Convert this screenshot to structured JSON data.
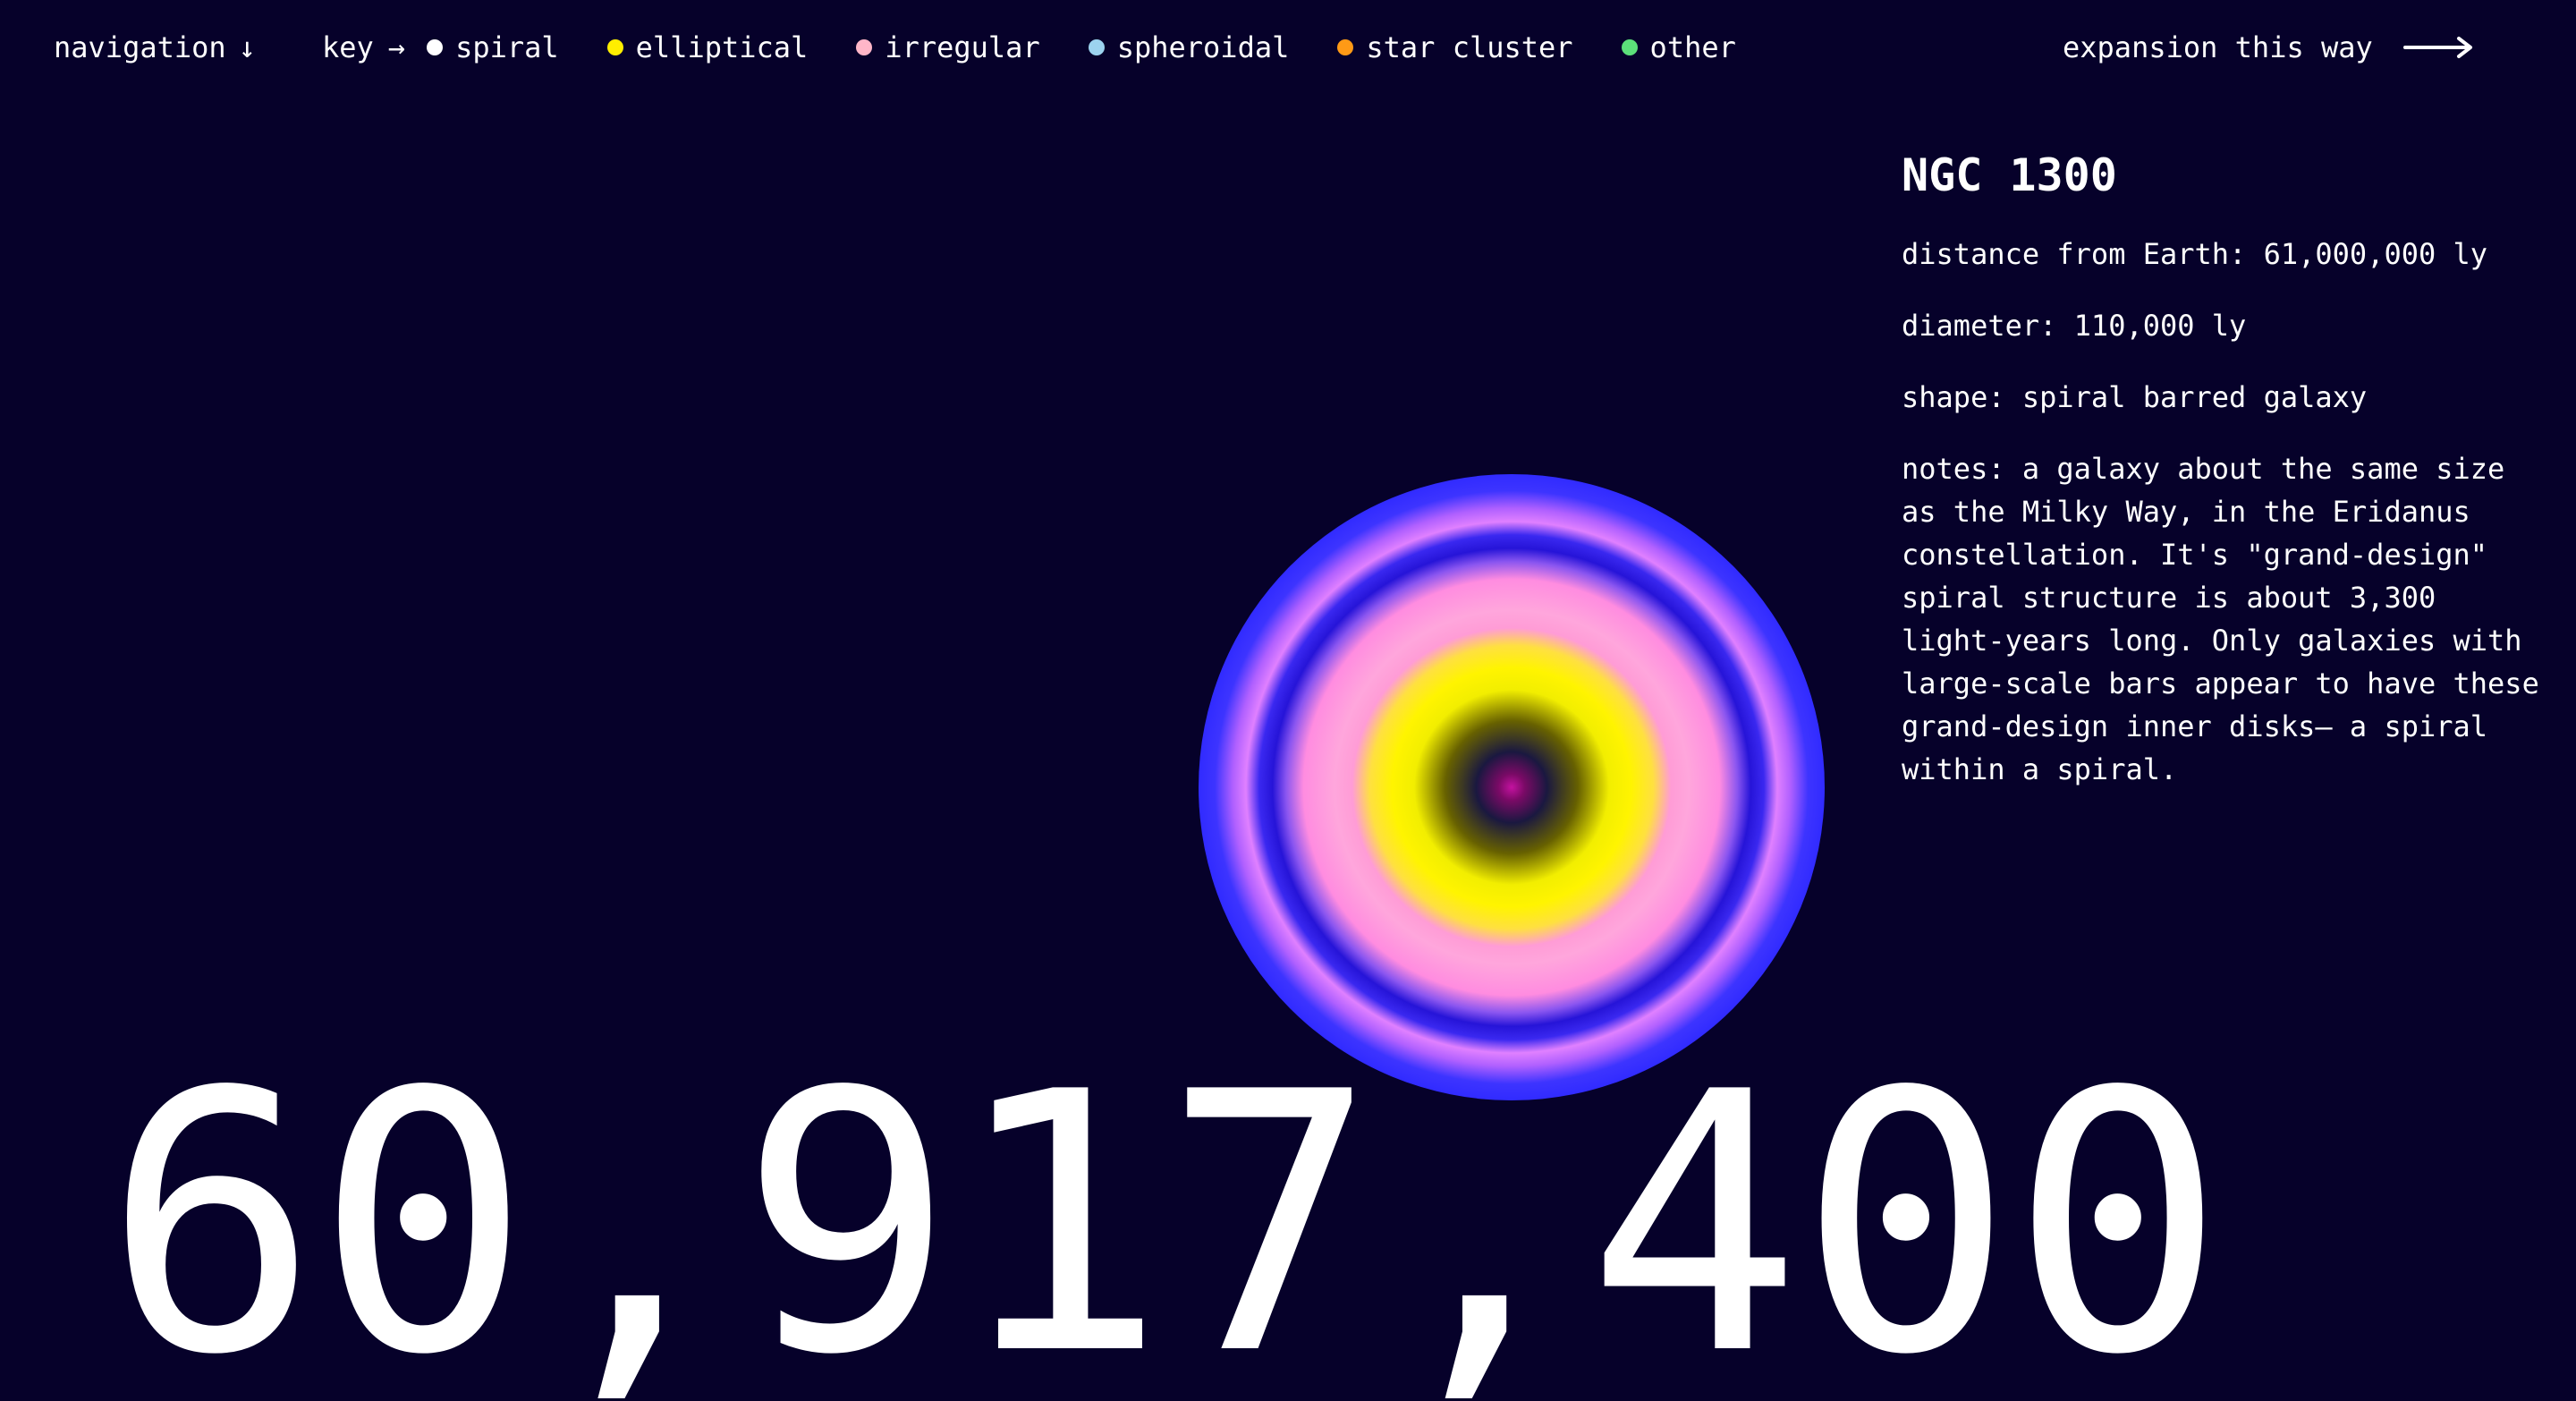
{
  "topbar": {
    "navigation_label": "navigation",
    "navigation_arrow": "↓",
    "key_label": "key",
    "key_arrow": "→",
    "key_items": [
      {
        "label": "spiral",
        "color": "#ffffff"
      },
      {
        "label": "elliptical",
        "color": "#ffee00"
      },
      {
        "label": "irregular",
        "color": "#ffb6c8"
      },
      {
        "label": "spheroidal",
        "color": "#9cd3ef"
      },
      {
        "label": "star cluster",
        "color": "#ff9a16"
      },
      {
        "label": "other",
        "color": "#5ce07a"
      }
    ],
    "expansion_label": "expansion this way",
    "expansion_icon": "long-right-arrow"
  },
  "galaxy": {
    "name": "NGC 1300",
    "distance": "distance from Earth: 61,000,000 ly",
    "diameter": "diameter: 110,000 ly",
    "shape": "shape: spiral barred galaxy",
    "notes": "notes: a galaxy about the same size as the Milky Way, in the Eridanus constellation. It's \"grand-design\" spiral structure is about 3,300 light-years long. Only galaxies with large-scale bars appear to have these grand-design inner disks— a spiral within a spiral.",
    "type_color": "#ffffff"
  },
  "counter": {
    "value": "60,917,400"
  },
  "colors": {
    "background": "#06012a",
    "text": "#ffffff"
  }
}
